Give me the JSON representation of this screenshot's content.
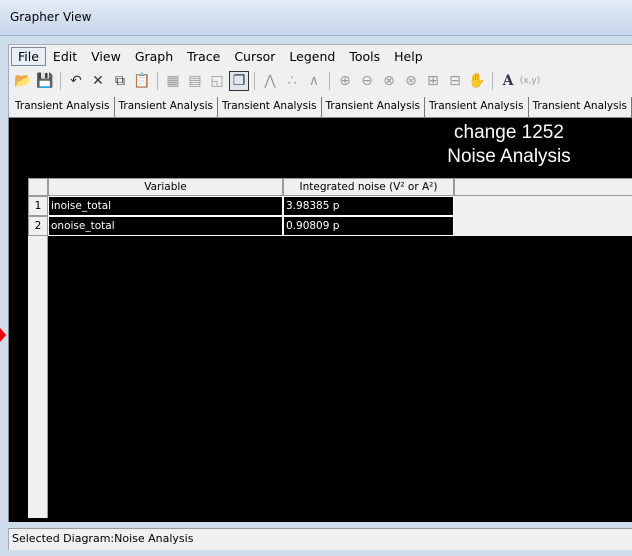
{
  "window": {
    "title": "Grapher View"
  },
  "menu": [
    "File",
    "Edit",
    "View",
    "Graph",
    "Trace",
    "Cursor",
    "Legend",
    "Tools",
    "Help"
  ],
  "toolbar": {
    "icons": [
      "open-folder-icon",
      "save-icon",
      "undo-icon",
      "delete-icon",
      "copy-icon",
      "paste-icon",
      "grid-icon",
      "grid-lines-icon",
      "graph-icon",
      "overlay-icon",
      "line-trace-icon",
      "scatter-trace-icon",
      "line-points-trace-icon",
      "zoom-in-icon",
      "zoom-out-icon",
      "zoom-x-icon",
      "zoom-y-icon",
      "zoom-fit-icon",
      "zoom-window-icon",
      "pan-hand-icon",
      "text-icon",
      "label-icon"
    ],
    "text_glyph": "A",
    "label_glyph": "(x,y)"
  },
  "tabs": [
    "Transient Analysis",
    "Transient Analysis",
    "Transient Analysis",
    "Transient Analysis",
    "Transient Analysis",
    "Transient Analysis"
  ],
  "plot": {
    "title_line1": "change 1252",
    "title_line2": "Noise Analysis",
    "table": {
      "headers": [
        "Variable",
        "Integrated noise (V² or A²)"
      ],
      "rows": [
        {
          "num": "1",
          "variable": "inoise_total",
          "value": "3.98385 p"
        },
        {
          "num": "2",
          "variable": "onoise_total",
          "value": "0.90809 p"
        }
      ]
    }
  },
  "status": {
    "text": "Selected Diagram:Noise Analysis"
  }
}
